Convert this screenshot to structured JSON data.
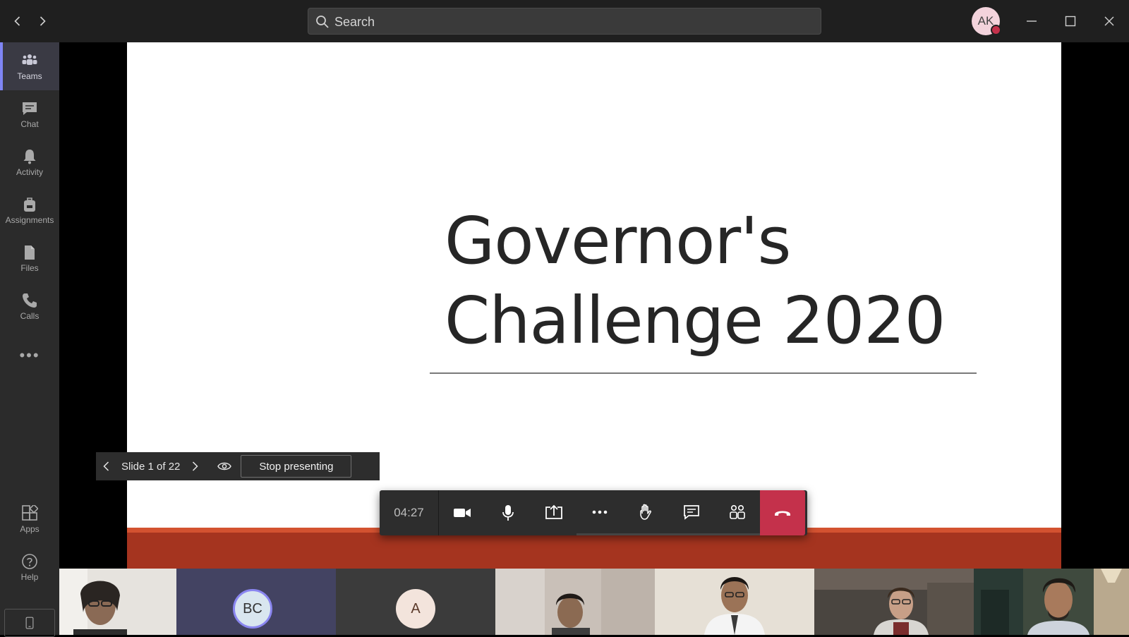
{
  "titlebar": {
    "search_placeholder": "Search",
    "avatar_initials": "AK",
    "presence_color": "#c4314b"
  },
  "rail": {
    "items": [
      {
        "label": "Teams",
        "icon": "teams-icon",
        "active": true
      },
      {
        "label": "Chat",
        "icon": "chat-icon"
      },
      {
        "label": "Activity",
        "icon": "bell-icon"
      },
      {
        "label": "Assignments",
        "icon": "backpack-icon"
      },
      {
        "label": "Files",
        "icon": "file-icon"
      },
      {
        "label": "Calls",
        "icon": "phone-icon"
      }
    ],
    "more": "•••",
    "bottom_items": [
      {
        "label": "Apps",
        "icon": "apps-icon"
      },
      {
        "label": "Help",
        "icon": "help-icon"
      }
    ]
  },
  "slide": {
    "title_line1": "Governor's",
    "title_line2": "Challenge 2020",
    "accent_color": "#a5341f"
  },
  "presenter": {
    "slide_counter": "Slide 1 of 22",
    "stop_label": "Stop presenting"
  },
  "call": {
    "timer": "04:27",
    "hangup_color": "#c4314b"
  },
  "participants": [
    {
      "type": "video"
    },
    {
      "type": "initials",
      "initials": "BC"
    },
    {
      "type": "initials",
      "initials": "A"
    },
    {
      "type": "video"
    },
    {
      "type": "video"
    },
    {
      "type": "video"
    },
    {
      "type": "video"
    }
  ]
}
